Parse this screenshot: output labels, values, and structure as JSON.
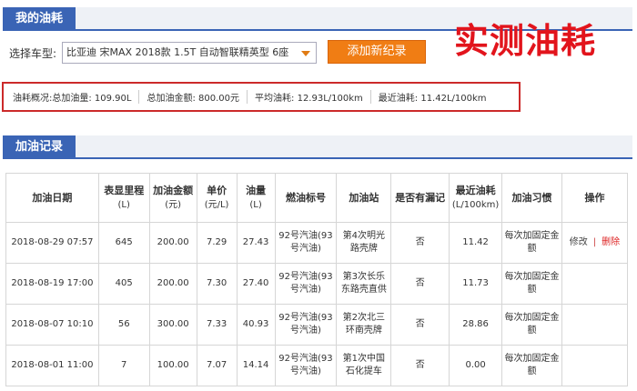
{
  "section1": {
    "title": "我的油耗"
  },
  "vehicle": {
    "label": "选择车型:",
    "selected": "比亚迪 宋MAX 2018款 1.5T 自动智联精英型 6座"
  },
  "add_button": "添加新纪录",
  "headline": "实测油耗",
  "summary": {
    "total_fuel": "油耗概况:总加油量: 109.90L",
    "total_amount": "总加油金额: 800.00元",
    "avg_consumption": "平均油耗: 12.93L/100km",
    "recent_consumption": "最近油耗: 11.42L/100km"
  },
  "section2": {
    "title": "加油记录"
  },
  "table": {
    "headers": [
      {
        "label": "加油日期",
        "unit": ""
      },
      {
        "label": "表显里程",
        "unit": "(L)"
      },
      {
        "label": "加油金额",
        "unit": "(元)"
      },
      {
        "label": "单价",
        "unit": "(元/L)"
      },
      {
        "label": "油量",
        "unit": "(L)"
      },
      {
        "label": "燃油标号",
        "unit": ""
      },
      {
        "label": "加油站",
        "unit": ""
      },
      {
        "label": "是否有漏记",
        "unit": ""
      },
      {
        "label": "最近油耗",
        "unit": "(L/100km)"
      },
      {
        "label": "加油习惯",
        "unit": ""
      },
      {
        "label": "操作",
        "unit": ""
      }
    ],
    "rows": [
      {
        "date": "2018-08-29 07:57",
        "mileage": "645",
        "amount": "200.00",
        "price": "7.29",
        "volume": "27.43",
        "fuel": "92号汽油(93号汽油)",
        "station": "第4次明光路壳牌",
        "missed": "否",
        "recent": "11.42",
        "habit": "每次加固定金额",
        "edit": "修改",
        "sep": "|",
        "delete": "删除"
      },
      {
        "date": "2018-08-19 17:00",
        "mileage": "405",
        "amount": "200.00",
        "price": "7.30",
        "volume": "27.40",
        "fuel": "92号汽油(93号汽油)",
        "station": "第3次长乐东路壳直供",
        "missed": "否",
        "recent": "11.73",
        "habit": "每次加固定金额",
        "edit": "",
        "sep": "",
        "delete": ""
      },
      {
        "date": "2018-08-07 10:10",
        "mileage": "56",
        "amount": "300.00",
        "price": "7.33",
        "volume": "40.93",
        "fuel": "92号汽油(93号汽油)",
        "station": "第2次北三环南壳牌",
        "missed": "否",
        "recent": "28.86",
        "habit": "每次加固定金额",
        "edit": "",
        "sep": "",
        "delete": ""
      },
      {
        "date": "2018-08-01 11:00",
        "mileage": "7",
        "amount": "100.00",
        "price": "7.07",
        "volume": "14.14",
        "fuel": "92号汽油(93号汽油)",
        "station": "第1次中国石化提车",
        "missed": "否",
        "recent": "0.00",
        "habit": "每次加固定金额",
        "edit": "",
        "sep": "",
        "delete": ""
      }
    ]
  }
}
